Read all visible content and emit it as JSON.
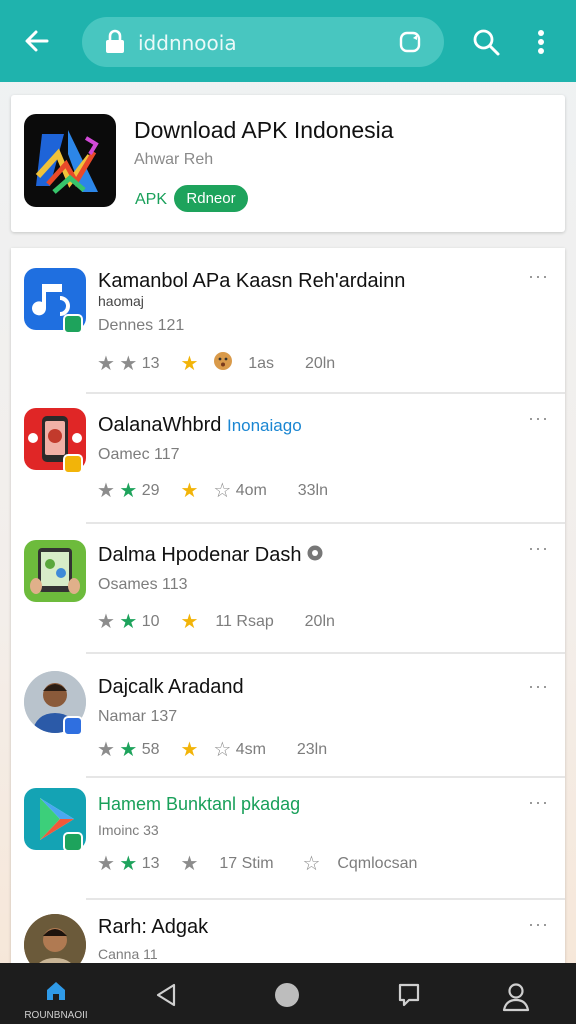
{
  "browser": {
    "url": "iddnnooia"
  },
  "header": {
    "title": "Download APK Indonesia",
    "subtitle": "Ahwar Reh",
    "tag": "APK",
    "badge": "Rdneor"
  },
  "apps": [
    {
      "title": "Kamanbol APa Kaasn Reh'ardainn",
      "title_line2": "haomaj",
      "meta": "Dennes 121",
      "stats": [
        "13",
        "1as",
        "20ln"
      ],
      "more": "···"
    },
    {
      "title": "OalanaWhbrd",
      "title_accent": "Inonaiago",
      "meta": "Oamec 117",
      "stats": [
        "29",
        "4om",
        "33ln"
      ],
      "more": "···"
    },
    {
      "title": "Dalma Hpodenar Dash",
      "meta": "Osames 113",
      "stats": [
        "10",
        "11 Rsap",
        "20ln"
      ],
      "more": "···"
    },
    {
      "title": "Dajcalk Aradand",
      "meta": "Namar 137",
      "stats": [
        "58",
        "4sm",
        "23ln"
      ],
      "more": "···"
    },
    {
      "title": "Hamem Bunktanl pkadag",
      "meta": "Imoinc 33",
      "stats": [
        "13",
        "17 Stim",
        "Cqmlocsan"
      ],
      "more": "···"
    },
    {
      "title": "Rarh: Adgak",
      "meta": "Canna 11",
      "more": "···"
    }
  ],
  "bottom_nav": {
    "home_label": "ROUNBNAOII"
  },
  "colors": {
    "toolbar": "#1fb3ad",
    "green": "#1ea35c",
    "gold": "#f2b409",
    "nav": "#1d1d1d"
  }
}
